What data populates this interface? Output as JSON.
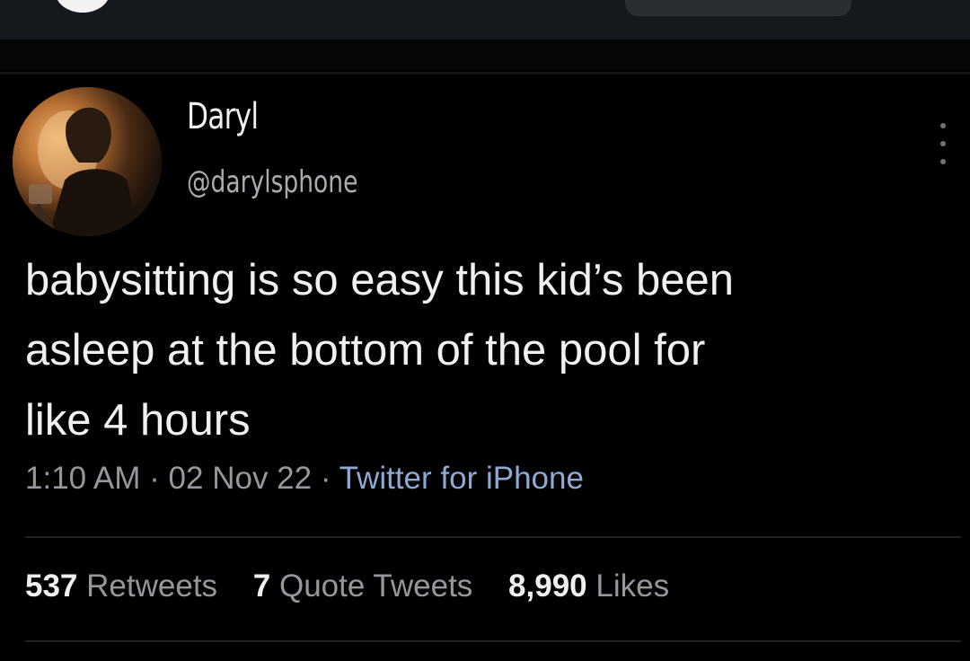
{
  "tweet": {
    "display_name": "Daryl",
    "handle": "@darylsphone",
    "text_lines": [
      "babysitting is so easy this kid’s been",
      "asleep at the bottom of the pool for",
      "like 4 hours"
    ],
    "time": "1:10 AM",
    "date": "02 Nov 22",
    "source": "Twitter for iPhone",
    "separator": "·",
    "stats": {
      "retweets_count": "537",
      "retweets_label": "Retweets",
      "quote_count": "7",
      "quote_label": "Quote Tweets",
      "likes_count": "8,990",
      "likes_label": "Likes"
    }
  },
  "icons": {
    "more": "more-vertical-icon",
    "avatar": "profile-photo"
  },
  "colors": {
    "background": "#000000",
    "text": "#eef0f1",
    "muted": "#94989c",
    "source_link": "#8ea9d4"
  }
}
